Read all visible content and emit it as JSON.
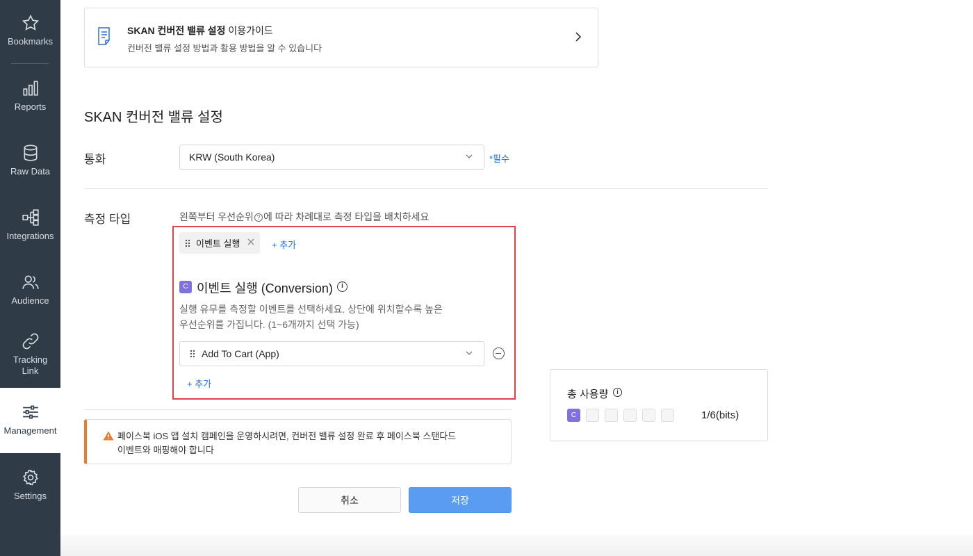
{
  "sidebar": {
    "items": [
      {
        "label": "Bookmarks",
        "icon": "star-icon"
      },
      {
        "label": "Reports",
        "icon": "bar-chart-icon"
      },
      {
        "label": "Raw Data",
        "icon": "database-icon"
      },
      {
        "label": "Integrations",
        "icon": "integrations-icon"
      },
      {
        "label": "Audience",
        "icon": "users-icon"
      },
      {
        "label": "Tracking Link",
        "icon": "link-icon"
      },
      {
        "label": "Management",
        "icon": "sliders-icon"
      },
      {
        "label": "Settings",
        "icon": "gear-icon"
      }
    ],
    "active": "Management"
  },
  "guide": {
    "title_bold": "SKAN 컨버전 밸류 설정",
    "title_rest": "이용가이드",
    "subtitle": "컨버전 밸류 설정 방법과 활용 방법을 알 수 있습니다"
  },
  "page_title": "SKAN 컨버전 밸류 설정",
  "currency": {
    "label": "통화",
    "value": "KRW (South Korea)",
    "required": "*필수"
  },
  "measure": {
    "label": "측정 타입",
    "hint_before": "왼쪽부터 우선순위",
    "hint_q": "?",
    "hint_after": "에 따라 차례대로 측정 타입을 배치하세요",
    "chip_label": "이벤트 실행",
    "add_label": "+ 추가"
  },
  "event": {
    "badge": "C",
    "title": "이벤트 실행 (Conversion)",
    "info": "i",
    "desc_line1": "실행 유무를 측정할 이벤트를 선택하세요. 상단에 위치할수록 높은",
    "desc_line2": "우선순위를 가집니다. (1~6개까지 선택 가능)",
    "selected_event": "Add To Cart (App)",
    "add_label": "+ 추가"
  },
  "warning": {
    "text_line1": "페이스북 iOS 앱 설치 캠페인을 운영하시려면, 컨버전 밸류 설정 완료 후 페이스북 스탠다드",
    "text_line2": "이벤트와 매핑해야 합니다"
  },
  "usage": {
    "title": "총 사용량",
    "info": "i",
    "used_badge": "C",
    "used_bits": 1,
    "total_bits": 6,
    "count": "1/6(bits)"
  },
  "buttons": {
    "cancel": "취소",
    "save": "저장"
  },
  "colors": {
    "sidebar_bg": "#2f3b46",
    "accent_blue": "#1e6fd9",
    "save_button": "#5a9cf2",
    "highlight_red": "#e0424b",
    "warning_orange": "#f07a2c",
    "conversion_purple": "#7e71e0"
  }
}
